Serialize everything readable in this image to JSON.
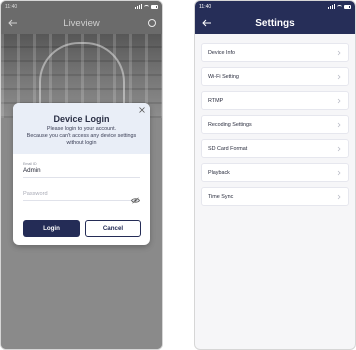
{
  "left_screen": {
    "status_time": "11:40",
    "title": "Liveview",
    "dialog": {
      "title": "Device Login",
      "message_line1": "Please login to your account.",
      "message_line2": "Because you can't access any device settings",
      "message_line3": "without login",
      "username_caption": "Email ID",
      "username_value": "Admin",
      "password_placeholder": "Password",
      "login_label": "Login",
      "cancel_label": "Cancel"
    }
  },
  "right_screen": {
    "status_time": "11:40",
    "title": "Settings",
    "items": [
      {
        "label": "Device Info"
      },
      {
        "label": "Wi-Fi Setting"
      },
      {
        "label": "RTMP"
      },
      {
        "label": "Recoding Settings"
      },
      {
        "label": "SD Card Format"
      },
      {
        "label": "Playback"
      },
      {
        "label": "Time Sync"
      }
    ]
  },
  "colors": {
    "navy": "#262e58",
    "dialog_header": "#e9eef7",
    "dim_background": "#8a8a8a"
  }
}
